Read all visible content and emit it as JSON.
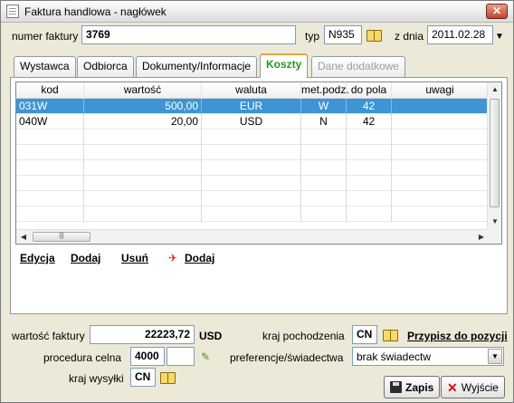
{
  "window": {
    "title": "Faktura handlowa - nagłówek",
    "close": "✕"
  },
  "header": {
    "invoice_label": "numer faktury",
    "invoice_value": "3769",
    "type_label": "typ",
    "type_value": "N935",
    "date_label": "z dnia",
    "date_value": "2011.02.28",
    "date_dropdown": "▼"
  },
  "tabs": [
    {
      "label": "Wystawca",
      "state": "normal"
    },
    {
      "label": "Odbiorca",
      "state": "normal"
    },
    {
      "label": "Dokumenty/Informacje",
      "state": "normal"
    },
    {
      "label": "Koszty",
      "state": "active"
    },
    {
      "label": "Dane dodatkowe",
      "state": "disabled"
    }
  ],
  "grid": {
    "columns": [
      "kod",
      "wartość",
      "waluta",
      "met.podz.",
      "do pola",
      "uwagi"
    ],
    "rows": [
      {
        "kod": "031W",
        "wartosc": "500,00",
        "waluta": "EUR",
        "met": "W",
        "pole": "42",
        "uwagi": ""
      },
      {
        "kod": "040W",
        "wartosc": "20,00",
        "waluta": "USD",
        "met": "N",
        "pole": "42",
        "uwagi": ""
      }
    ],
    "scroll_up": "▲",
    "scroll_down": "▼",
    "scroll_left": "◀",
    "scroll_right": "▶",
    "thumb_grip": "|||"
  },
  "actions": {
    "edit": "Edycja",
    "add": "Dodaj",
    "remove": "Usuń",
    "add_plane": "Dodaj",
    "plane_icon": "✈"
  },
  "footer": {
    "value_label": "wartość faktury",
    "value": "22223,72",
    "currency": "USD",
    "procedure_label": "procedura celna",
    "procedure_value": "4000",
    "procedure_extra": "",
    "dispatch_label": "kraj wysyłki",
    "dispatch_value": "CN",
    "origin_label": "kraj pochodzenia",
    "origin_value": "CN",
    "assign_link": "Przypisz do pozycji",
    "pref_label": "preferencje/świadectwa",
    "pref_value": "brak świadectw",
    "pref_dropdown": "▼",
    "save": "Zapis",
    "exit": "Wyjście",
    "exit_icon": "✕",
    "pencil_icon": "✎"
  }
}
